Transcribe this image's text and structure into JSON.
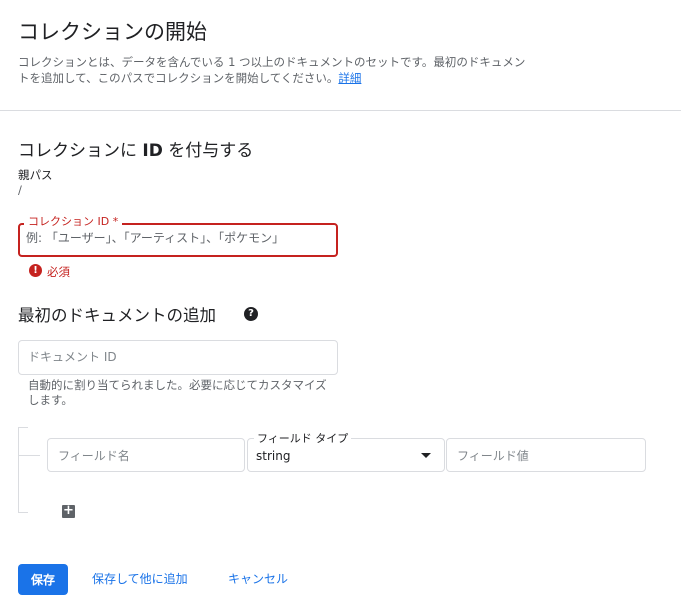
{
  "header": {
    "title": "コレクションの開始",
    "description": "コレクションとは、データを含んでいる 1 つ以上のドキュメントのセットです。最初のドキュメントを追加して、このパスでコレクションを開始してください。",
    "details_link": "詳細"
  },
  "collection_section": {
    "title_prefix": "コレクションに",
    "title_bold": "ID",
    "title_suffix": "を付与する",
    "parent_path_label": "親パス",
    "parent_path_value": "/",
    "collection_id": {
      "label": "コレクション ID *",
      "value": "",
      "placeholder": "例: 「ユーザー」、「アーティスト」、「ポケモン」",
      "error": "必須",
      "error_icon": "error-icon",
      "error_color": "#c5221f"
    }
  },
  "document_section": {
    "title": "最初のドキュメントの追加",
    "help_icon": "help-icon",
    "document_id": {
      "placeholder": "ドキュメント ID",
      "value": "",
      "hint": "自動的に割り当てられました。必要に応じてカスタマイズします。"
    },
    "field_row": {
      "name_placeholder": "フィールド名",
      "type_label": "フィールド タイプ",
      "type_value": "string",
      "value_placeholder": "フィールド値"
    },
    "add_field_icon": "plus-icon"
  },
  "actions": {
    "save": "保存",
    "save_and_add": "保存して他に追加",
    "cancel": "キャンセル"
  },
  "colors": {
    "accent": "#1a73e8",
    "error": "#c5221f"
  }
}
